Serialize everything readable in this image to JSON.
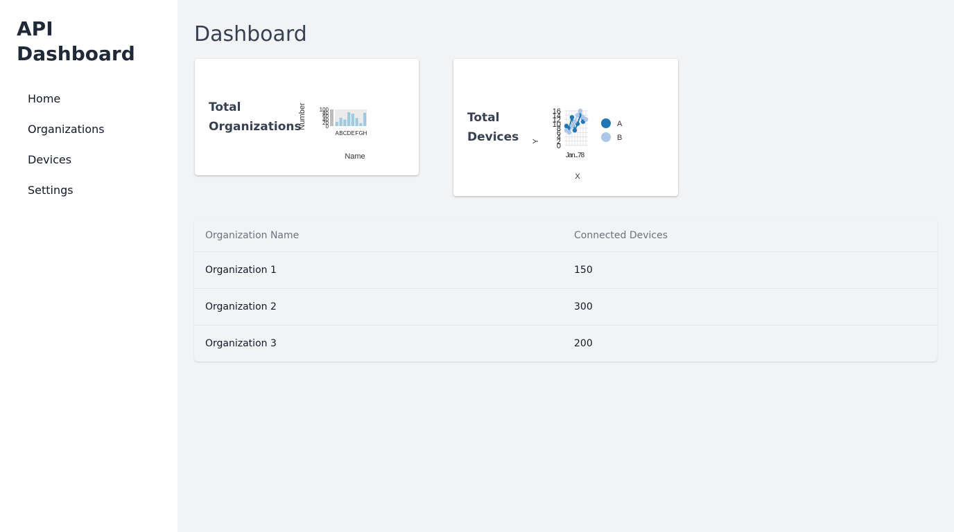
{
  "sidebar": {
    "title": "API Dashboard",
    "items": [
      {
        "label": "Home"
      },
      {
        "label": "Organizations"
      },
      {
        "label": "Devices"
      },
      {
        "label": "Settings"
      }
    ]
  },
  "main": {
    "title": "Dashboard",
    "cards": [
      {
        "label": "Total Organizations"
      },
      {
        "label": "Total Devices"
      }
    ],
    "table": {
      "columns": [
        "Organization Name",
        "Connected Devices"
      ],
      "rows": [
        [
          "Organization 1",
          "150"
        ],
        [
          "Organization 2",
          "300"
        ],
        [
          "Organization 3",
          "200"
        ]
      ]
    }
  },
  "chart_data": [
    {
      "type": "bar",
      "xlabel": "Name",
      "ylabel": "Number",
      "categories": [
        "A",
        "B",
        "C",
        "D",
        "E",
        "F",
        "G",
        "H"
      ],
      "values": [
        28,
        55,
        43,
        91,
        81,
        53,
        19,
        87
      ],
      "y_ticks": [
        "0",
        "20",
        "40",
        "60",
        "80",
        "100"
      ],
      "ylim": [
        0,
        100
      ],
      "colors": {
        "bar": "#9ecae1",
        "background": "#ebebeb"
      }
    },
    {
      "type": "line",
      "xlabel": "X",
      "ylabel": "Y",
      "y_ticks": [
        "0",
        "2",
        "4",
        "6",
        "8",
        "10",
        "12",
        "14",
        "16"
      ],
      "ylim": [
        0,
        16
      ],
      "x": [
        1,
        2,
        3,
        4,
        5,
        6,
        7,
        8
      ],
      "x_tick_label": "Jan...78",
      "series": [
        {
          "name": "A",
          "values": [
            9,
            8,
            13,
            7,
            10,
            14,
            11,
            12
          ],
          "color": "#1f77b4"
        },
        {
          "name": "B",
          "values": [
            7,
            6,
            9,
            11,
            14,
            16,
            13,
            12
          ],
          "color": "#aec7e8"
        }
      ]
    }
  ]
}
